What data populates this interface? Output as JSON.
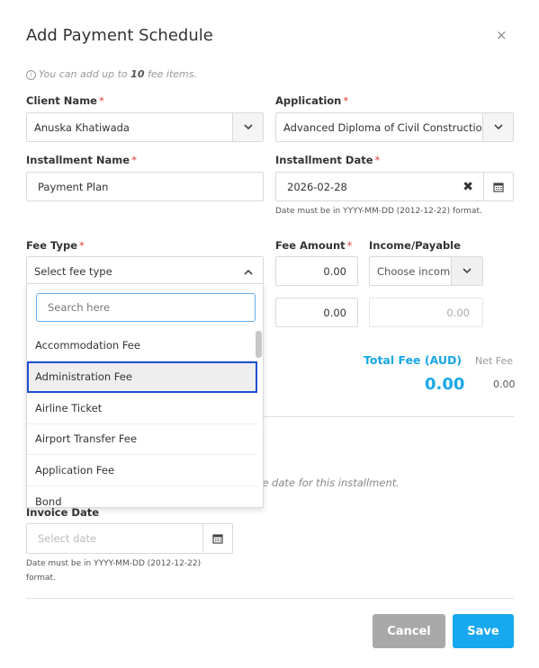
{
  "modal": {
    "title": "Add Payment Schedule",
    "close_icon": "×",
    "hint_prefix": "You can add up to ",
    "hint_count": "10",
    "hint_suffix": " fee items."
  },
  "form": {
    "client_name_label": "Client Name",
    "client_name_value": "Anuska Khatiwada",
    "application_label": "Application",
    "application_value": "Advanced Diploma of Civil Construction",
    "installment_name_label": "Installment Name",
    "installment_name_value": "Payment Plan",
    "installment_date_label": "Installment Date",
    "installment_date_value": "2026-02-28",
    "date_format_note": "Date must be in YYYY-MM-DD (2012-12-22) format.",
    "required_mark": "*"
  },
  "fees": {
    "fee_type_label": "Fee Type",
    "fee_type_placeholder": "Select fee type",
    "fee_amount_label": "Fee Amount",
    "income_payable_label": "Income/Payable",
    "row1_amount": "0.00",
    "row1_income_placeholder": "Choose income",
    "row2_amount": "0.00",
    "row2_income_amount": "0.00",
    "search_placeholder": "Search here",
    "options": [
      "Accommodation Fee",
      "Administration Fee",
      "Airline Ticket",
      "Airport Transfer Fee",
      "Application Fee",
      "Bond"
    ],
    "highlighted_option": "Administration Fee"
  },
  "totals": {
    "total_label": "Total Fee (AUD)",
    "total_value": "0.00",
    "net_label": "Net Fee",
    "net_value": "0.00"
  },
  "invoice": {
    "partial_hint": "ce date for this installment.",
    "invoice_date_label": "Invoice Date",
    "invoice_date_placeholder": "Select date",
    "date_note_line1": "Date must be in YYYY-MM-DD (2012-12-22)",
    "date_note_line2": "format."
  },
  "footer": {
    "cancel_label": "Cancel",
    "save_label": "Save"
  },
  "colors": {
    "accent_blue": "#1aa7e8",
    "save_button": "#18a8f0",
    "cancel_button": "#a9a9a9",
    "required_red": "#e53935",
    "highlight_border": "#1f4fd1"
  },
  "icons": {
    "info": "info-icon",
    "close": "close-icon",
    "chevron_down": "chevron-down-icon",
    "chevron_up": "chevron-up-icon",
    "clear": "clear-icon",
    "calendar": "calendar-icon"
  }
}
